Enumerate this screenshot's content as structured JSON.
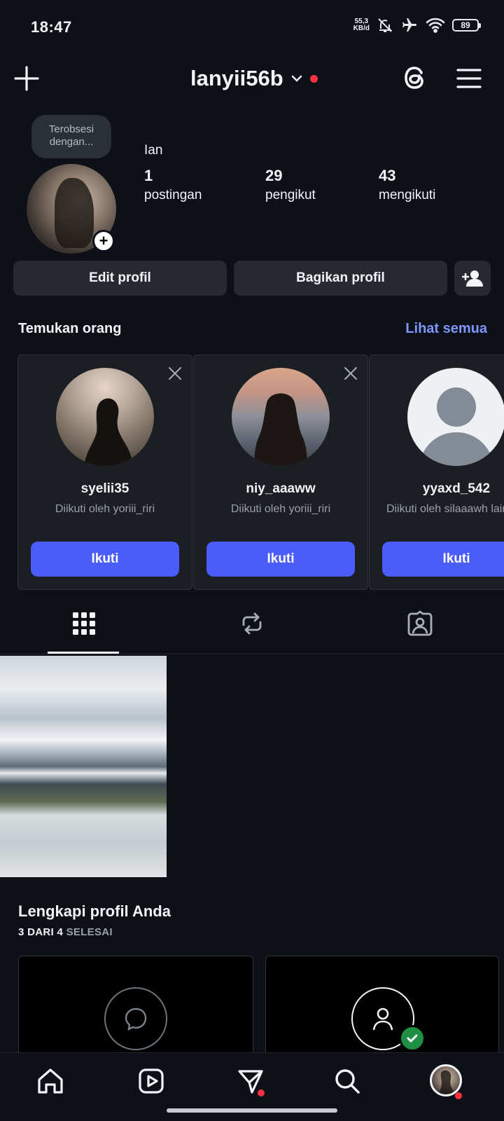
{
  "status_bar": {
    "time": "18:47",
    "net_speed_value": "55,3",
    "net_speed_unit": "KB/d",
    "battery": "89"
  },
  "header": {
    "username": "lanyii56b"
  },
  "profile": {
    "note": "Terobsesi dengan...",
    "display_name": "Ian",
    "stats": [
      {
        "value": "1",
        "label": "postingan"
      },
      {
        "value": "29",
        "label": "pengikut"
      },
      {
        "value": "43",
        "label": "mengikuti"
      }
    ],
    "edit_label": "Edit profil",
    "share_label": "Bagikan profil"
  },
  "discover": {
    "title": "Temukan orang",
    "see_all": "Lihat semua",
    "cards": [
      {
        "username": "syelii35",
        "subtitle": "Diikuti oleh yoriii_riri",
        "button": "Ikuti"
      },
      {
        "username": "niy_aaaww",
        "subtitle": "Diikuti oleh yoriii_riri",
        "button": "Ikuti"
      },
      {
        "username": "yyaxd_542",
        "subtitle": "Diikuti oleh silaaawh lainnya",
        "button": "Ikuti"
      }
    ]
  },
  "complete_profile": {
    "title": "Lengkapi profil Anda",
    "progress": "3 DARI 4",
    "status": "SELESAI"
  },
  "colors": {
    "background": "#0d1117",
    "accent": "#4a5df9",
    "link": "#7f96ff",
    "notification": "#ff3040",
    "success": "#1f8f45"
  }
}
